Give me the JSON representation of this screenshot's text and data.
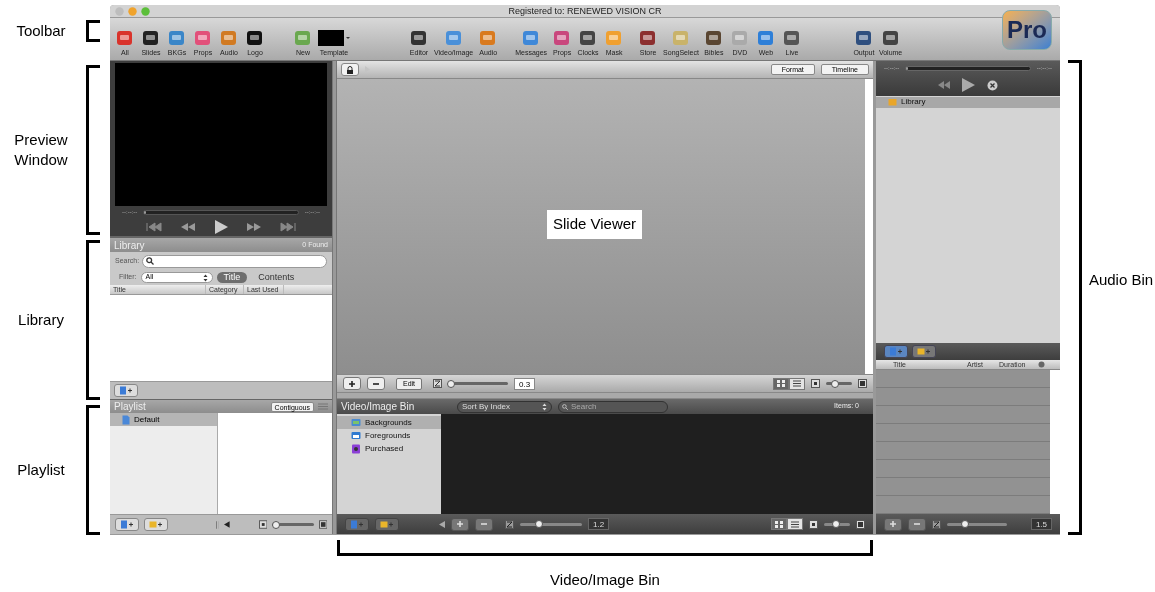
{
  "window": {
    "title": "Registered to: RENEWED VISION CR",
    "logo": "Pro"
  },
  "toolbar": {
    "groups": [
      [
        {
          "label": "All"
        },
        {
          "label": "Slides"
        },
        {
          "label": "BKGs"
        },
        {
          "label": "Props"
        },
        {
          "label": "Audio"
        },
        {
          "label": "Logo"
        }
      ],
      [
        {
          "label": "New"
        },
        {
          "label": "Template"
        }
      ],
      [
        {
          "label": "Editor"
        },
        {
          "label": "Video/Image"
        },
        {
          "label": "Audio"
        }
      ],
      [
        {
          "label": "Messages"
        },
        {
          "label": "Props"
        },
        {
          "label": "Clocks"
        },
        {
          "label": "Mask"
        }
      ],
      [
        {
          "label": "Store"
        },
        {
          "label": "SongSelect"
        },
        {
          "label": "Bibles"
        },
        {
          "label": "DVD"
        },
        {
          "label": "Web"
        },
        {
          "label": "Live"
        }
      ],
      [
        {
          "label": "Output"
        },
        {
          "label": "Volume"
        }
      ]
    ]
  },
  "preview": {
    "timecode_start": "--:--:--",
    "timecode_end": "--:--:--",
    "progress": {
      "level": 0
    }
  },
  "library": {
    "title": "Library",
    "count": "0 Found",
    "search_label": "Search:",
    "filter_label": "Filter:",
    "filter_value": "All",
    "modes": [
      {
        "label": "Title",
        "selected": true
      },
      {
        "label": "Contents",
        "selected": false
      }
    ],
    "columns": [
      "Title",
      "Category",
      "Last Used"
    ]
  },
  "playlist": {
    "title": "Playlist",
    "mode_button": "Contiguous",
    "items": [
      {
        "label": "Default",
        "selected": true
      }
    ],
    "slider": {
      "level": 0.1
    }
  },
  "slide_viewer": {
    "buttons": [
      "Format",
      "Timeline"
    ],
    "edit_button": "Edit",
    "zoom": {
      "level": 0.05,
      "reading": "0.3"
    },
    "views": [
      {
        "kind": "grid",
        "selected": true
      },
      {
        "kind": "list",
        "selected": false
      }
    ],
    "size": {
      "level": 0.35
    }
  },
  "video_bin": {
    "title": "Video/Image Bin",
    "sort": "Sort By Index",
    "search_placeholder": "Search",
    "count": "Items: 0",
    "folders": [
      {
        "label": "Backgrounds",
        "selected": true
      },
      {
        "label": "Foregrounds",
        "selected": false
      },
      {
        "label": "Purchased",
        "selected": false
      }
    ],
    "zoom": {
      "level": 0.3,
      "reading": "1.2"
    },
    "views": [
      {
        "kind": "grid",
        "selected": true
      },
      {
        "kind": "list",
        "selected": false
      }
    ],
    "size": {
      "level": 0.45
    }
  },
  "audio_bin": {
    "timecode_start": "--:--:--",
    "timecode_end": "--:--:--",
    "progress": {
      "level": 0
    },
    "tree": [
      {
        "label": "Library",
        "selected": true
      }
    ],
    "columns": [
      "Title",
      "Artist",
      "Duration"
    ],
    "zoom": {
      "level": 0.3,
      "reading": "1.5"
    }
  },
  "annotations": {
    "left": [
      "Toolbar",
      "Preview Window",
      "Library",
      "Playlist"
    ],
    "center": "Slide Viewer",
    "right": "Audio Bin",
    "bottom": "Video/Image Bin"
  }
}
